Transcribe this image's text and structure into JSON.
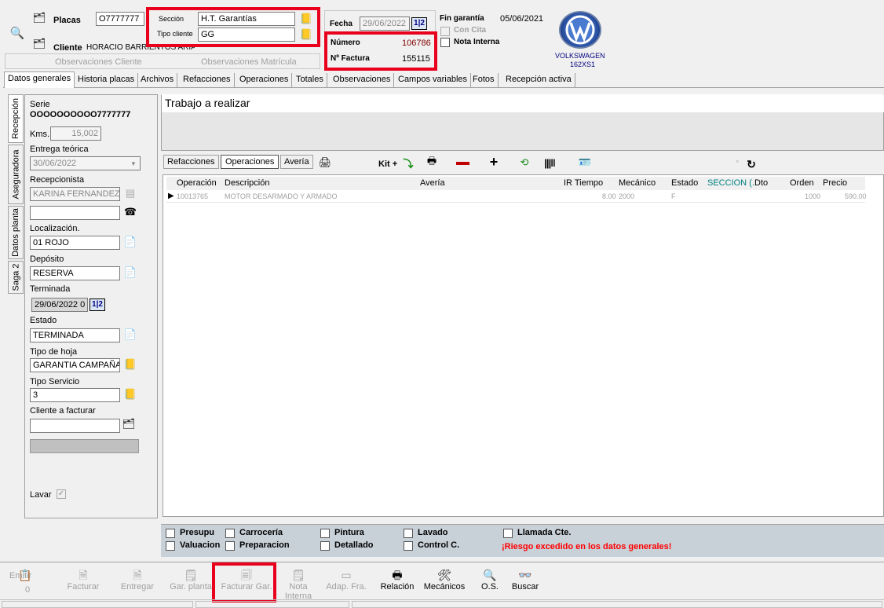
{
  "header": {
    "placas_label": "Placas",
    "placas_value": "O7777777",
    "cliente_label": "Cliente",
    "cliente_value": "HORACIO BARRIENTOS ARIAS",
    "seccion_label": "Sección",
    "seccion_value": "H.T. Garantías",
    "tipo_cliente_label": "Tipo cliente",
    "tipo_cliente_value": "GG",
    "obs_cliente": "Observaciones  Cliente",
    "obs_matricula": "Observaciones  Matrícula",
    "fecha_label": "Fecha",
    "fecha_value": "29/06/2022",
    "fecha_btn": "1|2",
    "numero_label": "Número",
    "numero_value": "106786",
    "factura_label": "Nº Factura",
    "factura_value": "155115",
    "fin_garantia_label": "Fin garantía",
    "fin_garantia_value": "05/06/2021",
    "con_cita": "Con Cita",
    "nota_interna": "Nota Interna",
    "brand": "VOLKSWAGEN",
    "model": "162XS1"
  },
  "tabs": [
    "Datos generales",
    "Historia placas",
    "Archivos",
    "Refacciones",
    "Operaciones",
    "Totales",
    "Observaciones",
    "Campos variables",
    "Fotos",
    "Recepción activa"
  ],
  "side_tabs": [
    "Recepción",
    "Aseguradora",
    "Datos planta",
    "Saga 2"
  ],
  "left": {
    "serie_label": "Serie",
    "serie_value": "OOOOOOOOOO7777777",
    "kms_label": "Kms.",
    "kms_value": "15,002",
    "entrega_label": "Entrega teórica",
    "entrega_value": "30/06/2022",
    "recepcionista_label": "Recepcionista",
    "recepcionista_value": "KARINA FERNANDEZ",
    "localizacion_label": "Localización.",
    "localizacion_value": "01 ROJO",
    "deposito_label": "Depósito",
    "deposito_value": "RESERVA",
    "terminada_label": "Terminada",
    "terminada_value": "29/06/2022 0",
    "terminada_btn": "1|2",
    "estado_label": "Estado",
    "estado_value": "TERMINADA",
    "tipo_hoja_label": "Tipo de hoja",
    "tipo_hoja_value": "GARANTIA CAMPAÑA",
    "tipo_servicio_label": "Tipo Servicio",
    "tipo_servicio_value": "3",
    "cliente_facturar_label": "Cliente a facturar",
    "cliente_facturar_value": "",
    "lavar_label": "Lavar"
  },
  "work": {
    "title": "Trabajo a realizar",
    "sub_tabs": [
      "Refacciones",
      "Operaciones",
      "Avería"
    ],
    "kit_label": "Kit +",
    "columns": [
      "Operación",
      "Descripción",
      "Avería",
      "IR Tiempo",
      "Mecánico",
      "Estado",
      "SECCION (..",
      "Dto",
      "Orden",
      "Precio"
    ],
    "rows": [
      {
        "operacion": "10013765",
        "descripcion": "MOTOR DESARMADO Y ARMADO",
        "averia": "",
        "ir": "",
        "tiempo": "8.00",
        "mecanico": "2000",
        "estado": "F",
        "seccion": "",
        "dto": "",
        "orden": "1000",
        "precio": "590.00"
      }
    ]
  },
  "checks": {
    "presupuesto": "Presupu",
    "valuacion": "Valuacion",
    "carroceria": "Carrocería",
    "preparacion": "Preparacion",
    "pintura": "Pintura",
    "detallado": "Detallado",
    "lavado": "Lavado",
    "control": "Control C.",
    "llamada": "Llamada Cte.",
    "warning": "¡Riesgo excedido en los datos generales!"
  },
  "toolbar": {
    "emitir": "Emitir",
    "emitir_count": "0",
    "facturar": "Facturar",
    "entregar": "Entregar",
    "gar_planta": "Gar. planta",
    "facturar_gar": "Facturar Gar.",
    "nota_interna": "Nota Interna",
    "adap_fra": "Adap. Fra.",
    "relacion": "Relación",
    "mecanicos": "Mecánicos",
    "os": "O.S.",
    "buscar": "Buscar"
  },
  "colors": {
    "highlight": "#e8001c",
    "teal": "#008080",
    "warning": "#ff0000",
    "numero": "#800000"
  }
}
